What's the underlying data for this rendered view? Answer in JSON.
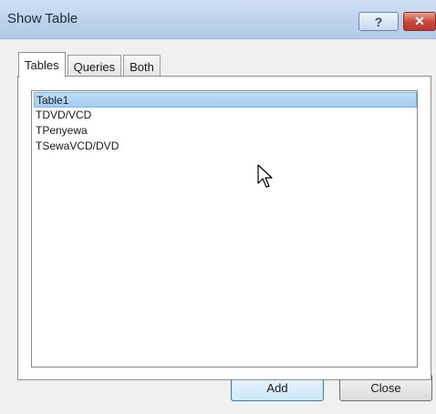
{
  "window": {
    "title": "Show Table",
    "help_glyph": "?",
    "close_glyph": "✕"
  },
  "tabs": [
    {
      "label": "Tables",
      "active": true
    },
    {
      "label": "Queries",
      "active": false
    },
    {
      "label": "Both",
      "active": false
    }
  ],
  "list": {
    "items": [
      {
        "label": "Table1",
        "selected": true
      },
      {
        "label": "TDVD/VCD",
        "selected": false
      },
      {
        "label": "TPenyewa",
        "selected": false
      },
      {
        "label": "TSewaVCD/DVD",
        "selected": false
      }
    ]
  },
  "buttons": {
    "add_label": "Add",
    "close_label": "Close"
  },
  "colors": {
    "selection": "#bcdcf7",
    "title_bar": "#bcd2ec",
    "close_button": "#c8463a"
  },
  "icons": {
    "pointer": "mouse-pointer-icon"
  }
}
